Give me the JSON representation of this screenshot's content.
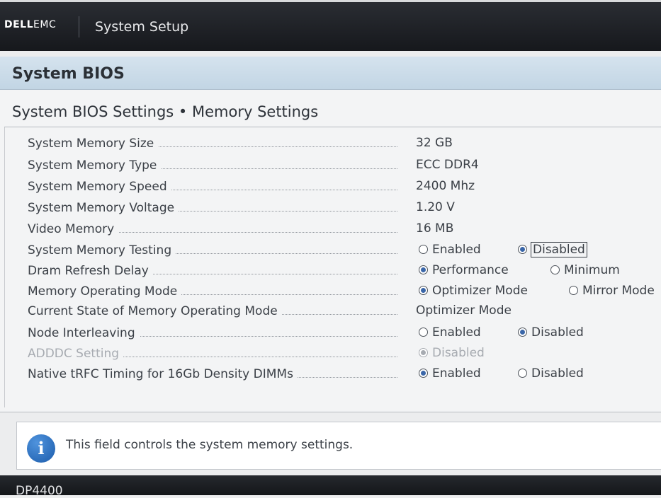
{
  "header": {
    "brand_dell": "DELL",
    "brand_emc": "EMC",
    "app_title": "System Setup"
  },
  "page": {
    "section_title": "System BIOS",
    "subtitle": "System BIOS Settings • Memory Settings"
  },
  "settings": [
    {
      "label": "System Memory Size",
      "value": "32 GB"
    },
    {
      "label": "System Memory Type",
      "value": "ECC DDR4"
    },
    {
      "label": "System Memory Speed",
      "value": "2400 Mhz"
    },
    {
      "label": "System Memory Voltage",
      "value": "1.20 V"
    },
    {
      "label": "Video Memory",
      "value": "16 MB"
    },
    {
      "label": "System Memory Testing",
      "options": [
        "Enabled",
        "Disabled"
      ],
      "selected": "Disabled"
    },
    {
      "label": "Dram Refresh Delay",
      "options": [
        "Performance",
        "Minimum"
      ],
      "selected": "Performance"
    },
    {
      "label": "Memory Operating Mode",
      "options": [
        "Optimizer Mode",
        "Mirror Mode"
      ],
      "selected": "Optimizer Mode"
    },
    {
      "label": "Current State of Memory Operating Mode",
      "value": "Optimizer Mode"
    },
    {
      "label": "Node Interleaving",
      "options": [
        "Enabled",
        "Disabled"
      ],
      "selected": "Disabled"
    },
    {
      "label": "ADDDC Setting",
      "options": [
        "Disabled"
      ],
      "selected": "Disabled",
      "disabled": true
    },
    {
      "label": "Native tRFC Timing for 16Gb Density DIMMs",
      "options": [
        "Enabled",
        "Disabled"
      ],
      "selected": "Enabled"
    }
  ],
  "info": {
    "icon": "info-icon",
    "text": "This field controls the system memory settings."
  },
  "footer": {
    "model": "DP4400"
  },
  "colors": {
    "header_bg": "#1f2126",
    "title_bar_bg": "#c9dbe8",
    "panel_bg": "#f3f4f5",
    "radio_selected": "#3a66a8",
    "disabled_text": "#a7abb1"
  }
}
